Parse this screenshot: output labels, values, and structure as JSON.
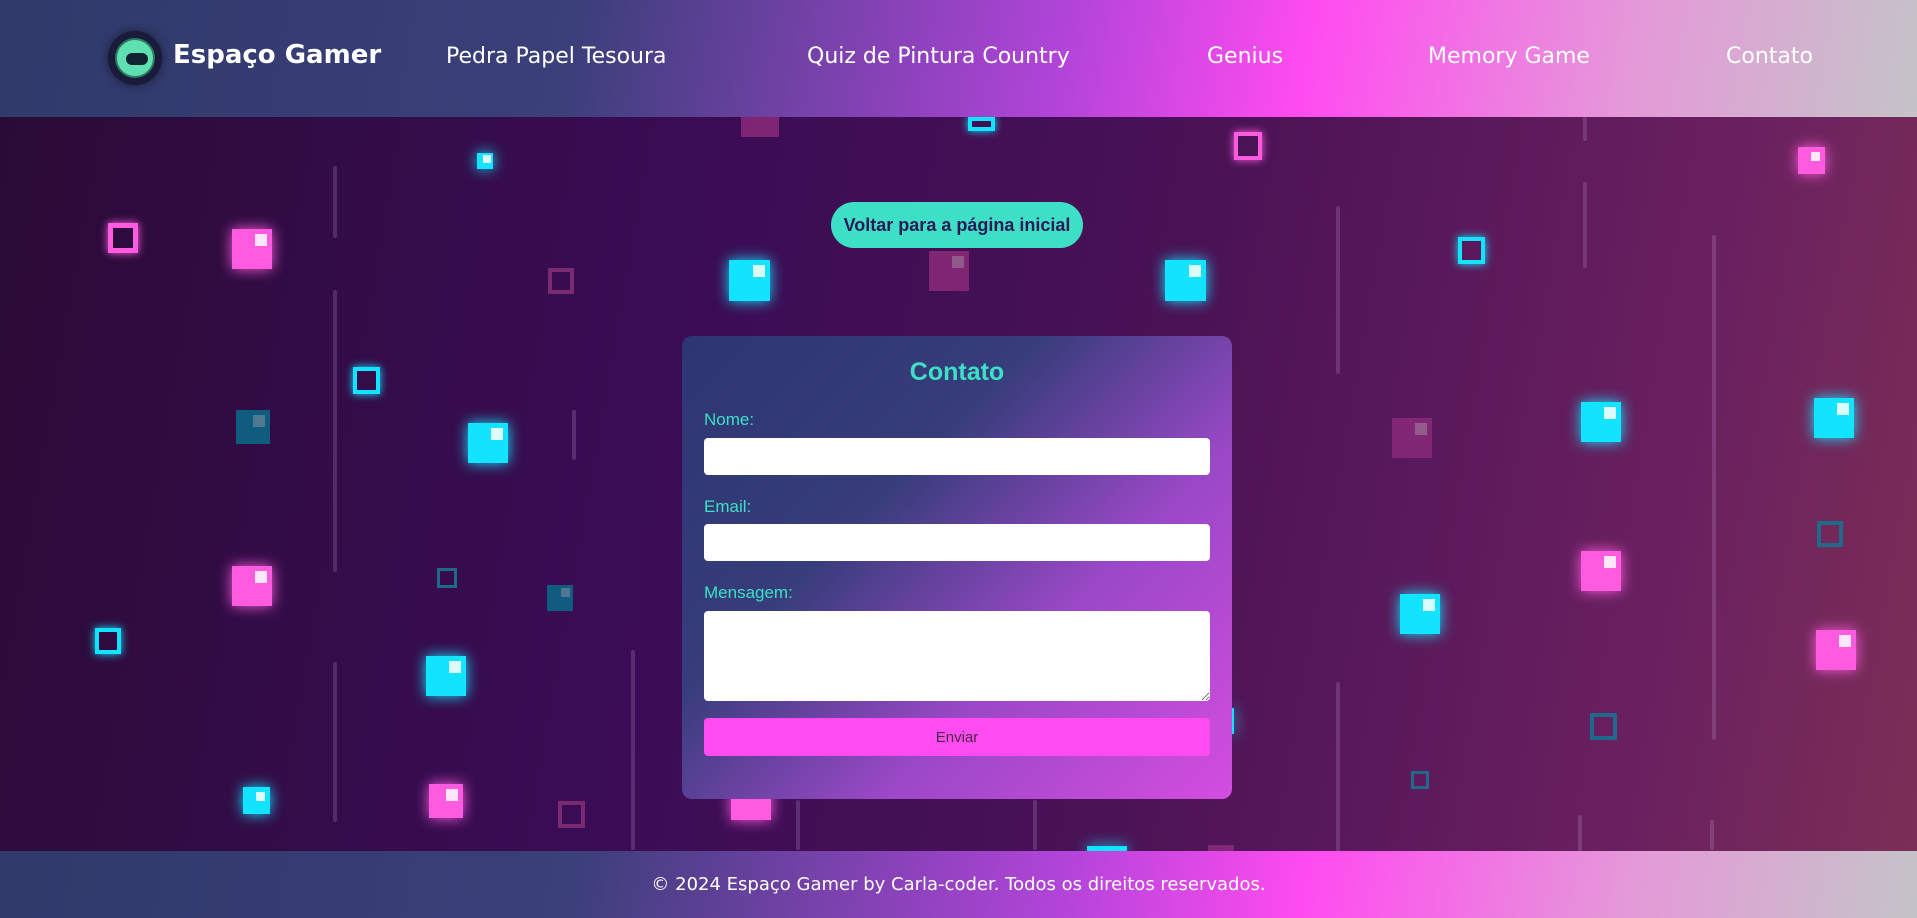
{
  "header": {
    "brand": "Espaço Gamer",
    "nav": [
      {
        "label": "Pedra Papel Tesoura"
      },
      {
        "label": "Quiz de Pintura Country"
      },
      {
        "label": "Genius"
      },
      {
        "label": "Memory Game"
      },
      {
        "label": "Contato"
      }
    ]
  },
  "back_button": {
    "label": "Voltar para a página inicial"
  },
  "form": {
    "title": "Contato",
    "name_label": "Nome:",
    "name_value": "",
    "email_label": "Email:",
    "email_value": "",
    "message_label": "Mensagem:",
    "message_value": "",
    "submit_label": "Enviar"
  },
  "footer": {
    "text": "© 2024 Espaço Gamer by Carla-coder. Todos os direitos reservados."
  },
  "colors": {
    "accent_teal": "#3de0c6",
    "accent_pink": "#ff4bf0",
    "neon_cyan": "#12e4ff",
    "neon_pink": "#ff5be1"
  },
  "icons": {
    "logo": "gamepad-icon"
  }
}
